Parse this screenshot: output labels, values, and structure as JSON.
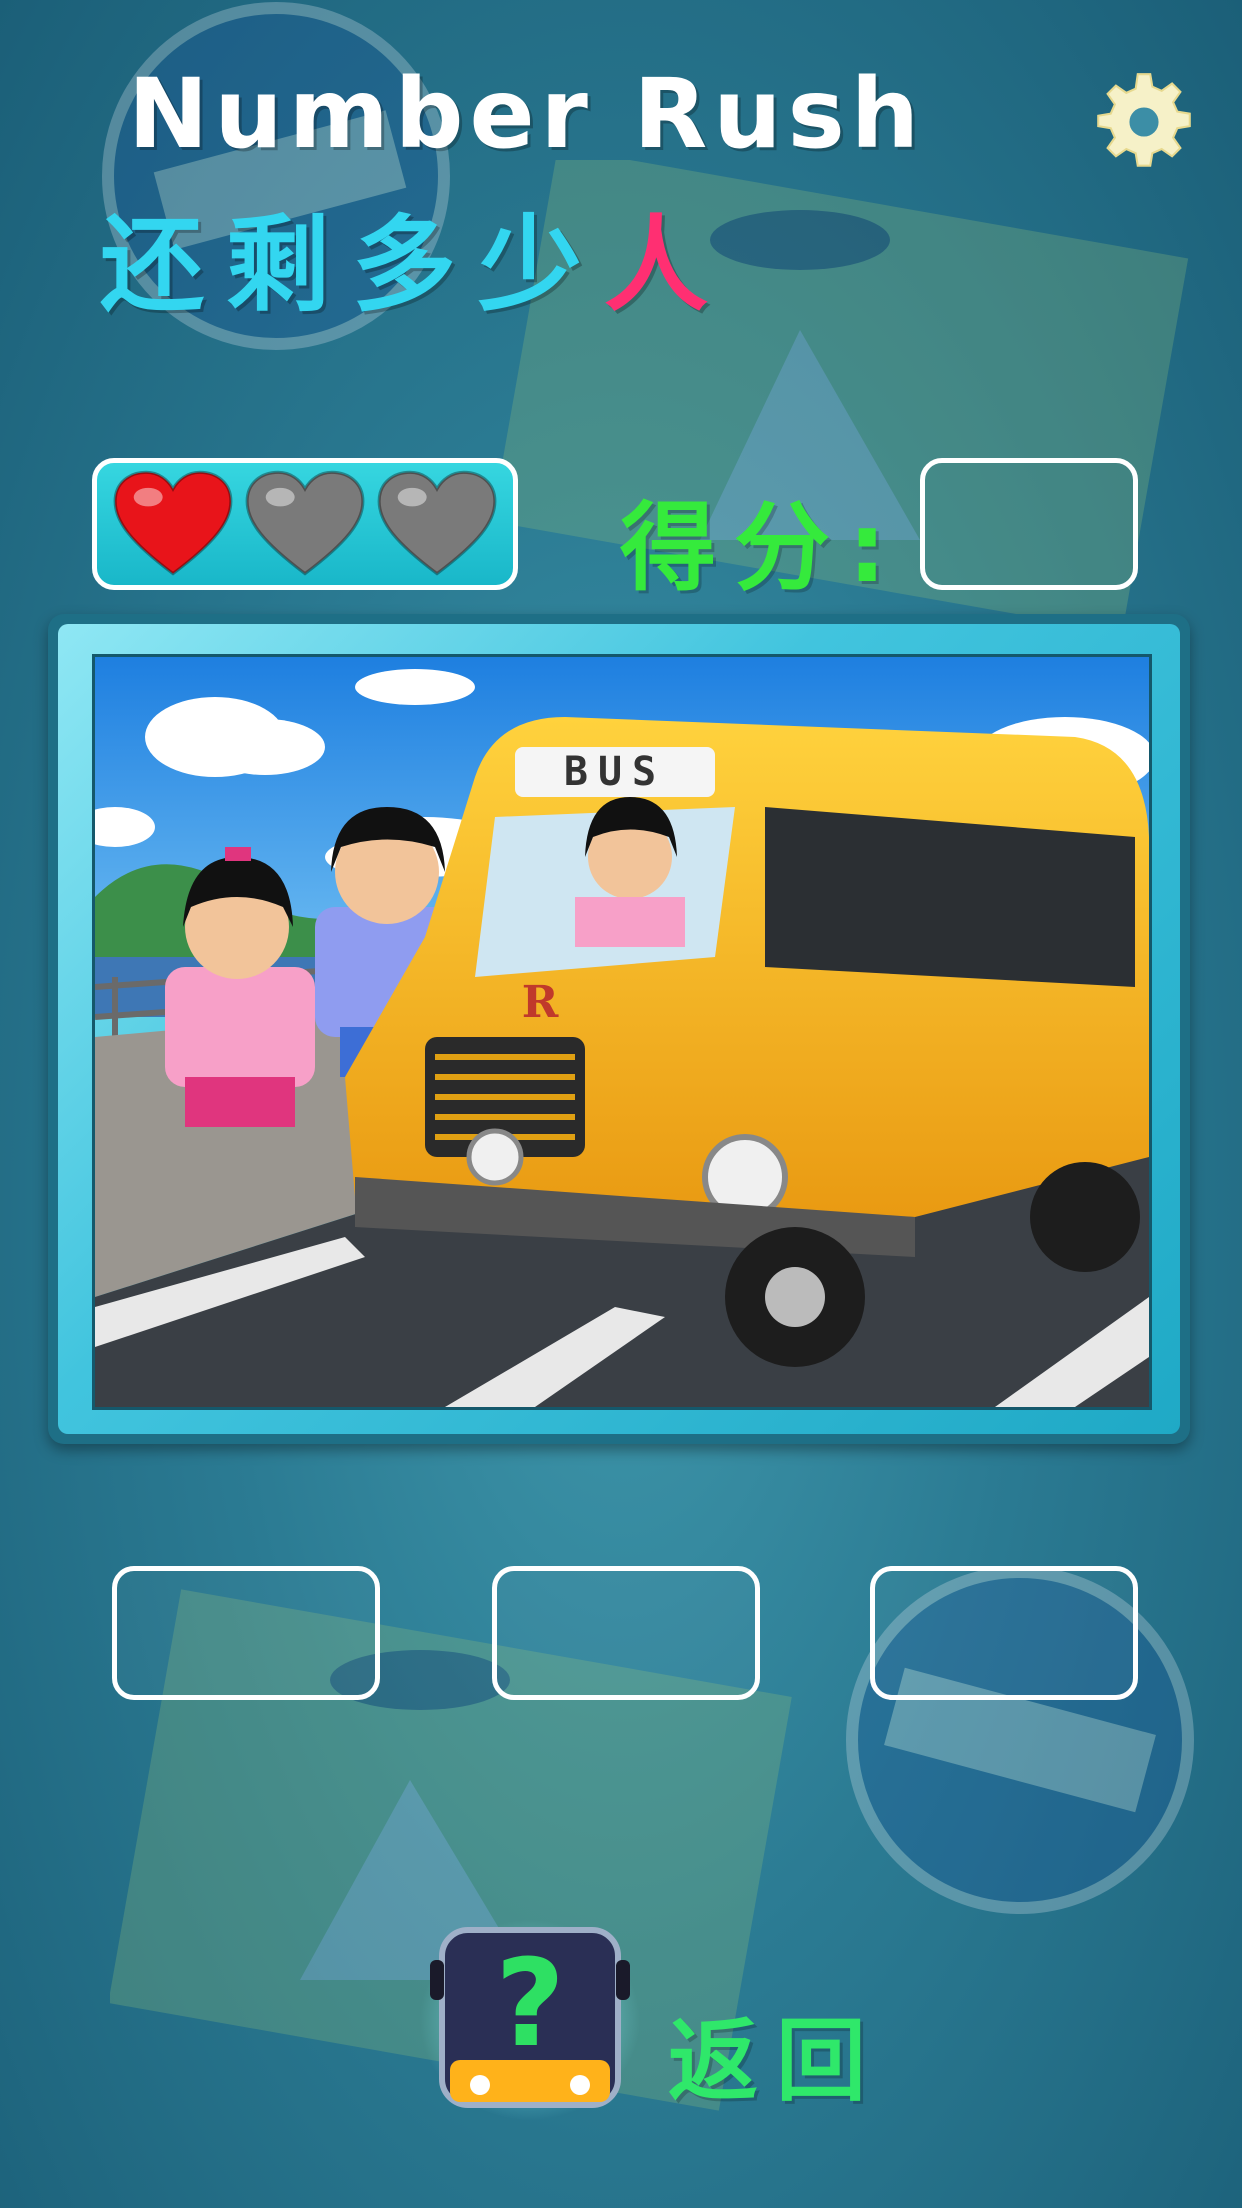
{
  "title": {
    "english": "Number Rush",
    "chinese_main": "还剩多少",
    "chinese_accent": "人"
  },
  "settings": {
    "icon": "gear-icon"
  },
  "lives": {
    "total": 3,
    "remaining": 1,
    "active_color": "#e8141a",
    "inactive_color": "#7a7a7a"
  },
  "score": {
    "label": "得分:",
    "value": ""
  },
  "scene": {
    "bus_sign": "BUS",
    "bus_emblem": "R"
  },
  "answers": [
    "",
    "",
    ""
  ],
  "help": {
    "icon": "bus-question-icon",
    "glyph": "?"
  },
  "back": {
    "label": "返回"
  },
  "colors": {
    "title_cn": "#33d6f0",
    "score_label": "#35ea3c",
    "back_label": "#2fe86a",
    "accent": "#ff2f72"
  }
}
